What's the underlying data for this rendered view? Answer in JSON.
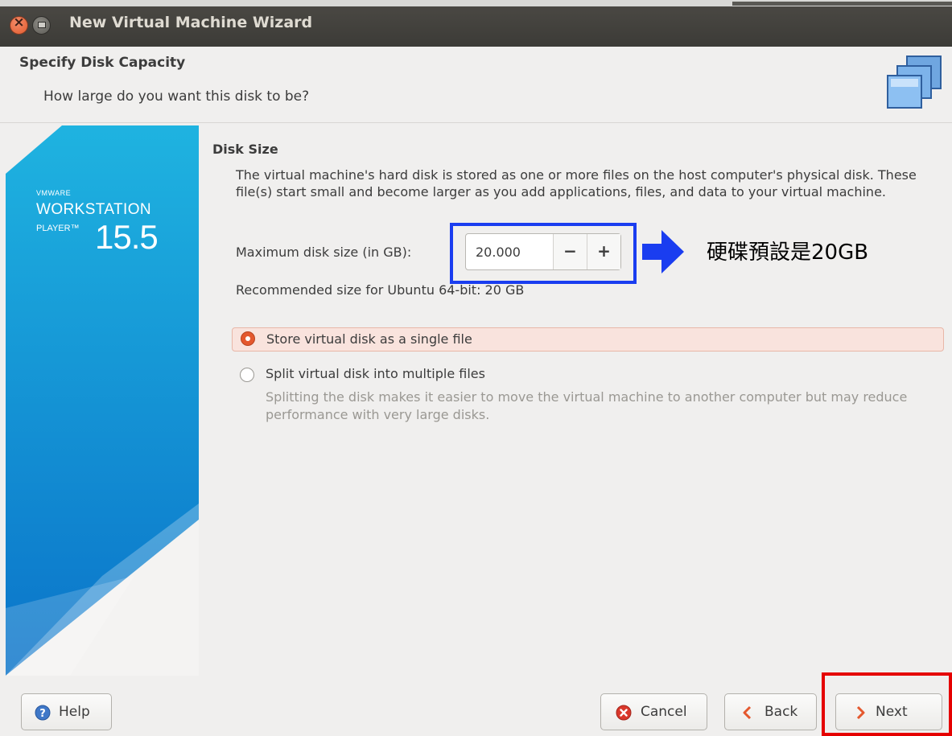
{
  "window": {
    "title": "New Virtual Machine Wizard"
  },
  "header": {
    "title": "Specify Disk Capacity",
    "subtitle": "How large do you want this disk to be?"
  },
  "brand": {
    "company": "VMWARE",
    "product": "WORKSTATION",
    "edition": "PLAYER™",
    "version": "15.5"
  },
  "disk": {
    "section_title": "Disk Size",
    "description": "The virtual machine's hard disk is stored as one or more files on the host computer's physical disk. These file(s) start small and become larger as you add applications, files, and data to your virtual machine.",
    "max_size_label": "Maximum disk size (in GB):",
    "max_size_value": "20.000",
    "decrement_label": "−",
    "increment_label": "+",
    "recommended": "Recommended size for Ubuntu 64-bit: 20 GB"
  },
  "options": {
    "single_file_label": "Store virtual disk as a single file",
    "single_file_selected": true,
    "split_files_label": "Split virtual disk into multiple files",
    "split_files_selected": false,
    "split_files_help": "Splitting the disk makes it easier to move the virtual machine to another computer but may reduce performance with very large disks."
  },
  "annotation": {
    "text": "硬碟預設是20GB"
  },
  "buttons": {
    "help": "Help",
    "cancel": "Cancel",
    "back": "Back",
    "next": "Next"
  },
  "colors": {
    "accent": "#e4582e",
    "brand_blue": "#1a8fd6",
    "annotation_blue": "#1a3df0",
    "annotation_red": "#e50000"
  }
}
